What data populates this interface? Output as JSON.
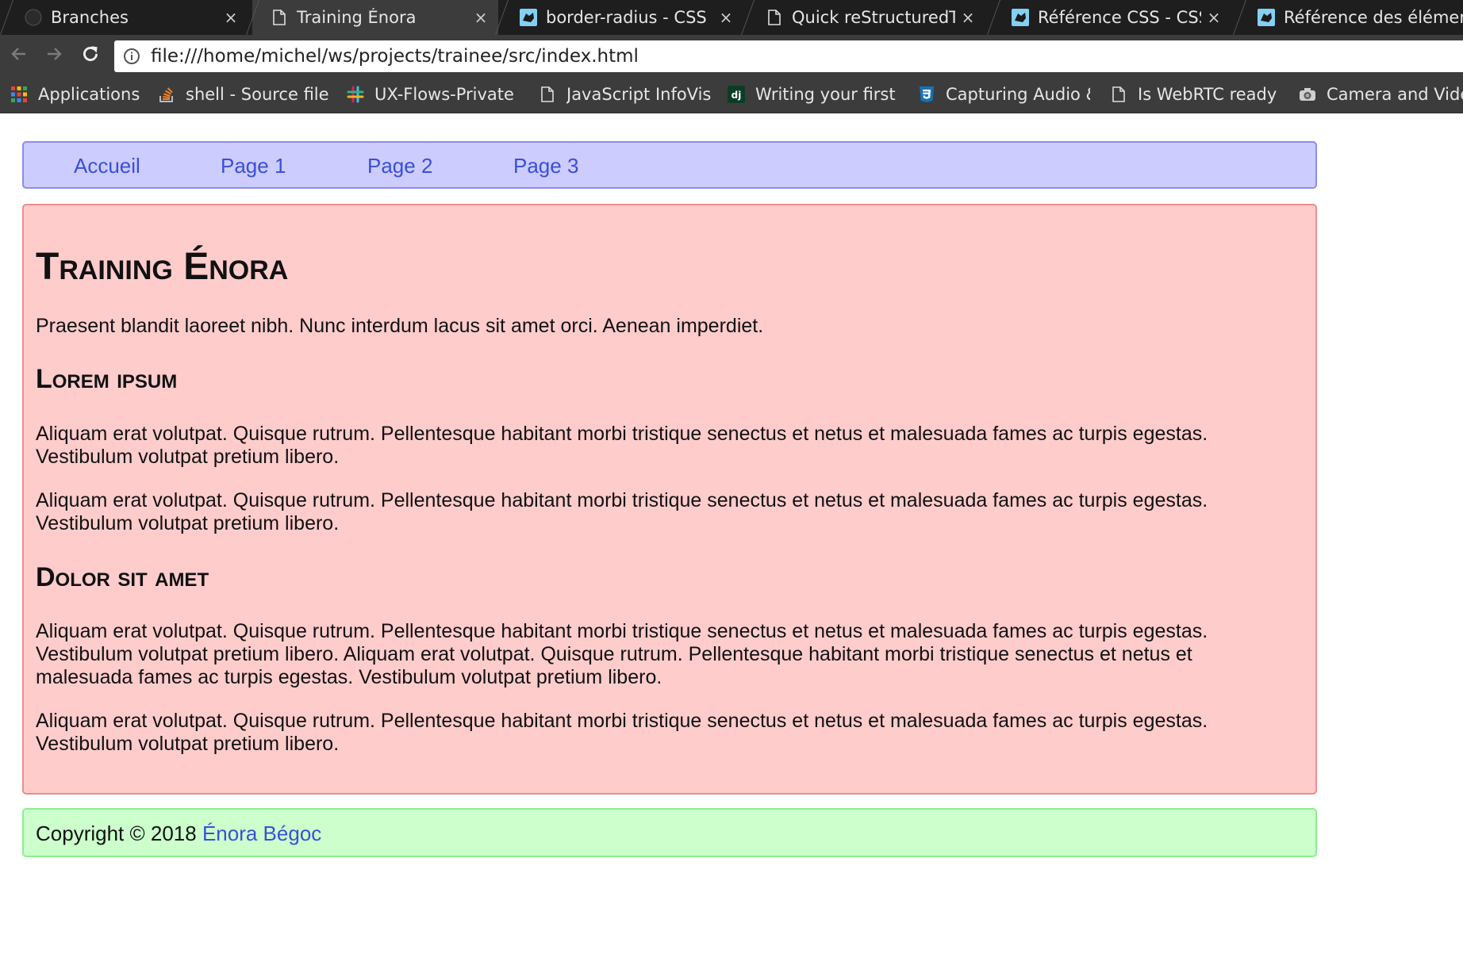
{
  "tabs": [
    {
      "title": "Branches",
      "icon": "github-icon",
      "active": false
    },
    {
      "title": "Training Énora",
      "icon": "file-icon",
      "active": true
    },
    {
      "title": "border-radius - CSS",
      "icon": "mdn-icon",
      "active": false
    },
    {
      "title": "Quick reStructuredText",
      "icon": "file-icon",
      "active": false
    },
    {
      "title": "Référence CSS - CSS",
      "icon": "mdn-icon",
      "active": false
    },
    {
      "title": "Référence des éléments",
      "icon": "mdn-icon",
      "active": false
    }
  ],
  "tab_close_glyph": "×",
  "toolbar": {
    "url": "file:///home/michel/ws/projects/trainee/src/index.html"
  },
  "bookmarks": [
    {
      "label": "Applications",
      "icon": "apps-grid-icon"
    },
    {
      "label": "shell - Source file",
      "icon": "stackoverflow-icon"
    },
    {
      "label": "UX-Flows-Private",
      "icon": "slack-icon"
    },
    {
      "label": "JavaScript InfoVis",
      "icon": "file-icon"
    },
    {
      "label": "Writing your first",
      "icon": "django-icon"
    },
    {
      "label": "Capturing Audio &",
      "icon": "css3-icon"
    },
    {
      "label": "Is WebRTC ready",
      "icon": "file-icon"
    },
    {
      "label": "Camera and Video",
      "icon": "camera-icon"
    }
  ],
  "page": {
    "nav": [
      "Accueil",
      "Page 1",
      "Page 2",
      "Page 3"
    ],
    "title": "Training Énora",
    "intro": "Praesent blandit laoreet nibh. Nunc interdum lacus sit amet orci. Aenean imperdiet.",
    "section1": {
      "heading": "Lorem ipsum",
      "paragraphs": [
        "Aliquam erat volutpat. Quisque rutrum. Pellentesque habitant morbi tristique senectus et netus et malesuada fames ac turpis egestas. Vestibulum volutpat pretium libero.",
        "Aliquam erat volutpat. Quisque rutrum. Pellentesque habitant morbi tristique senectus et netus et malesuada fames ac turpis egestas. Vestibulum volutpat pretium libero."
      ]
    },
    "section2": {
      "heading": "Dolor sit amet",
      "paragraphs": [
        "Aliquam erat volutpat. Quisque rutrum. Pellentesque habitant morbi tristique senectus et netus et malesuada fames ac turpis egestas. Vestibulum volutpat pretium libero. Aliquam erat volutpat. Quisque rutrum. Pellentesque habitant morbi tristique senectus et netus et malesuada fames ac turpis egestas. Vestibulum volutpat pretium libero.",
        "Aliquam erat volutpat. Quisque rutrum. Pellentesque habitant morbi tristique senectus et netus et malesuada fames ac turpis egestas. Vestibulum volutpat pretium libero."
      ]
    },
    "footer": {
      "text": "Copyright © 2018",
      "author": "Énora Bégoc"
    }
  },
  "colors": {
    "nav_bg": "#ccccff",
    "main_bg": "#ffcccc",
    "footer_bg": "#ccffcc",
    "link": "#3a4fd8"
  }
}
